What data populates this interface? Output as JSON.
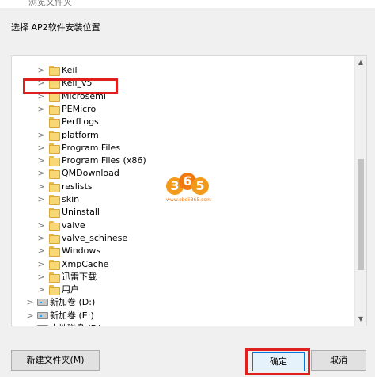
{
  "window": {
    "title": "浏览文件夹"
  },
  "instruction": "选择 AP2软件安装位置",
  "tree": {
    "items": [
      {
        "label": "Keil",
        "type": "folder",
        "expand": ">",
        "level": 2
      },
      {
        "label": "Keil_v5",
        "type": "folder",
        "expand": ">",
        "level": 2
      },
      {
        "label": "Microsemi",
        "type": "folder",
        "expand": ">",
        "level": 2
      },
      {
        "label": "PEMicro",
        "type": "folder",
        "expand": ">",
        "level": 2
      },
      {
        "label": "PerfLogs",
        "type": "folder",
        "expand": "",
        "level": 2
      },
      {
        "label": "platform",
        "type": "folder",
        "expand": ">",
        "level": 2
      },
      {
        "label": "Program Files",
        "type": "folder",
        "expand": ">",
        "level": 2
      },
      {
        "label": "Program Files (x86)",
        "type": "folder",
        "expand": ">",
        "level": 2
      },
      {
        "label": "QMDownload",
        "type": "folder",
        "expand": ">",
        "level": 2
      },
      {
        "label": "reslists",
        "type": "folder",
        "expand": ">",
        "level": 2
      },
      {
        "label": "skin",
        "type": "folder",
        "expand": ">",
        "level": 2
      },
      {
        "label": "Uninstall",
        "type": "folder",
        "expand": "",
        "level": 2
      },
      {
        "label": "valve",
        "type": "folder",
        "expand": ">",
        "level": 2
      },
      {
        "label": "valve_schinese",
        "type": "folder",
        "expand": ">",
        "level": 2
      },
      {
        "label": "Windows",
        "type": "folder",
        "expand": ">",
        "level": 2
      },
      {
        "label": "XmpCache",
        "type": "folder",
        "expand": ">",
        "level": 2
      },
      {
        "label": "迅雷下载",
        "type": "folder",
        "expand": ">",
        "level": 2
      },
      {
        "label": "用户",
        "type": "folder",
        "expand": ">",
        "level": 2
      },
      {
        "label": "新加卷 (D:)",
        "type": "drive",
        "expand": ">",
        "level": 1
      },
      {
        "label": "新加卷 (E:)",
        "type": "drive",
        "expand": ">",
        "level": 1
      },
      {
        "label": "本地磁盘 (F:)",
        "type": "drive",
        "expand": ">",
        "level": 1
      }
    ]
  },
  "watermark": {
    "d1": "3",
    "d2": "6",
    "d3": "5",
    "url": "www.obdii365.com"
  },
  "buttons": {
    "new_folder": "新建文件夹(M)",
    "ok": "确定",
    "cancel": "取消"
  },
  "colors": {
    "highlight": "#e0201f",
    "folder": "#f8d775",
    "accent": "#0078d7"
  }
}
